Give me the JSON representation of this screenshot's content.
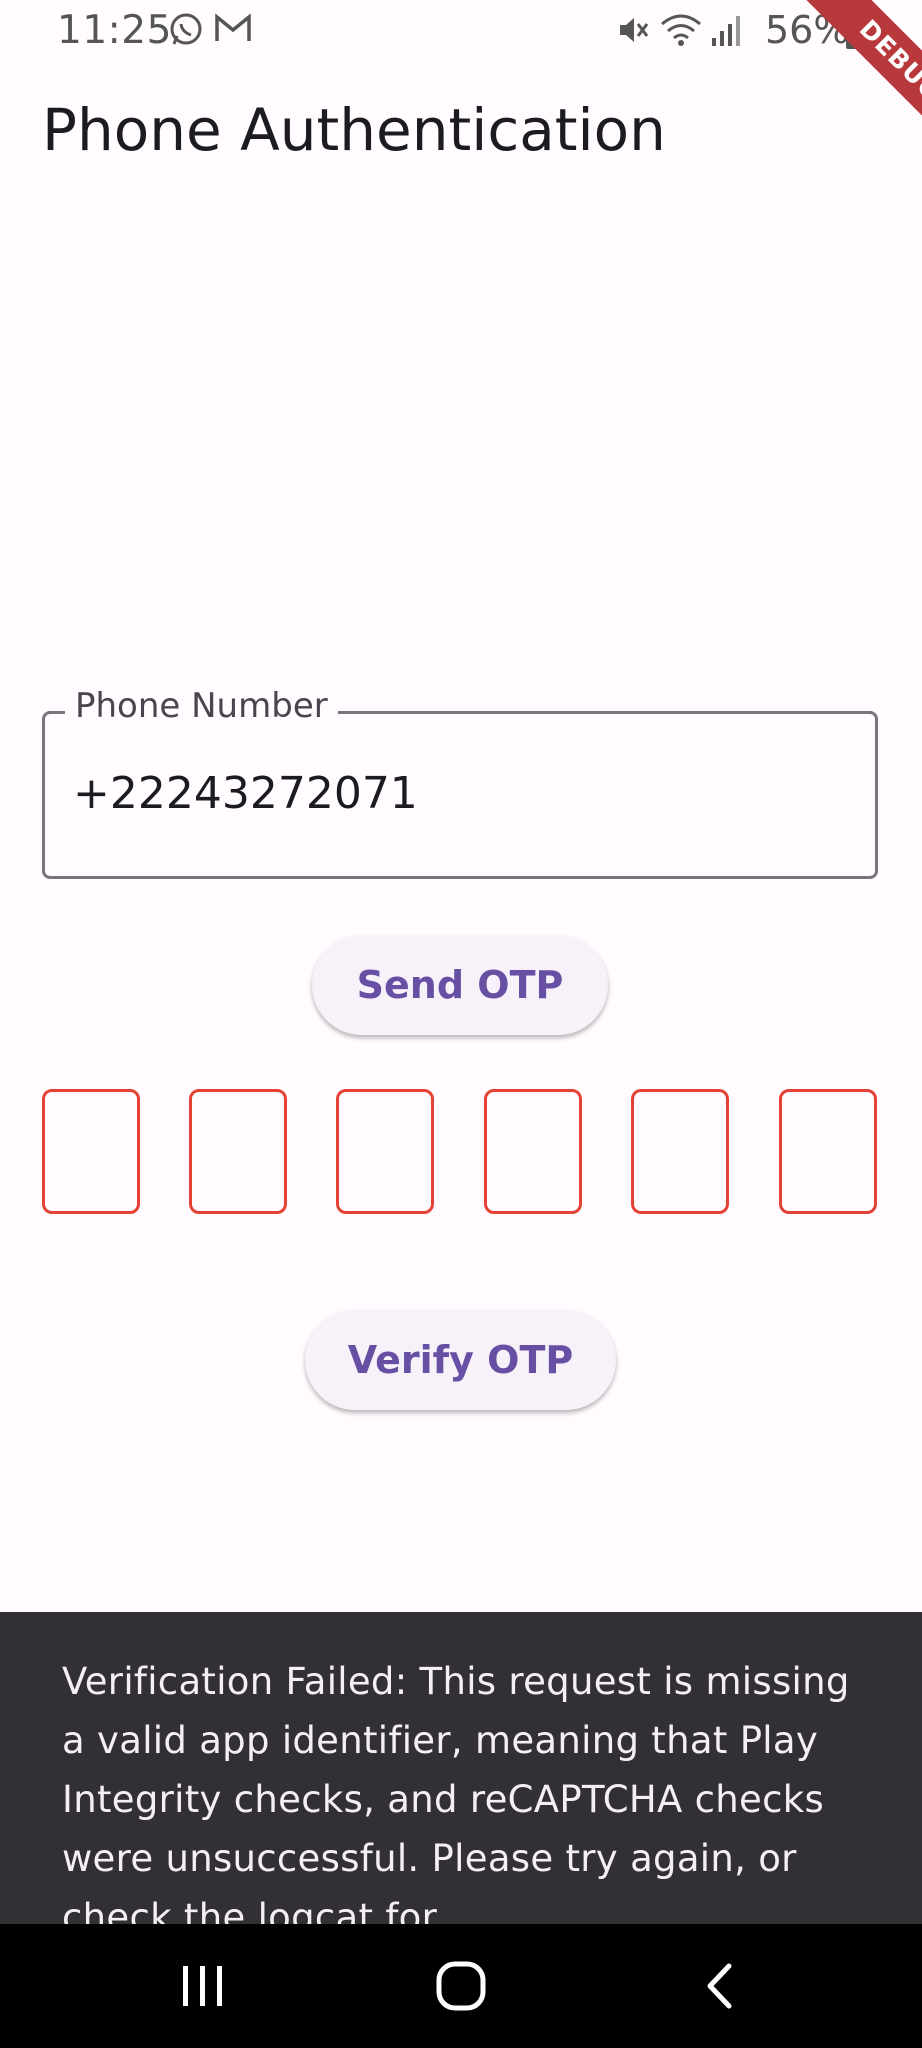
{
  "status_bar": {
    "time": "11:25",
    "battery": "56%",
    "icons": [
      "whatsapp-icon",
      "gmail-icon",
      "mute-icon",
      "wifi-icon",
      "signal-icon",
      "battery-icon"
    ]
  },
  "debug_banner": "DEBUG",
  "app_bar": {
    "title": "Phone Authentication"
  },
  "phone_field": {
    "label": "Phone Number",
    "value": "+22243272071"
  },
  "send_otp_button": {
    "label": "Send OTP"
  },
  "otp_boxes": [
    "",
    "",
    "",
    "",
    "",
    ""
  ],
  "verify_otp_button": {
    "label": "Verify OTP"
  },
  "snackbar": {
    "message": "Verification Failed: This request is missing a valid app identifier, meaning that Play Integrity checks, and reCAPTCHA checks were unsuccessful. Please try again, or check the logcat for"
  },
  "colors": {
    "primary": "#6750a4",
    "otp_border": "#e44235",
    "debug_banner": "#b8393c",
    "snackbar_bg": "#323034"
  },
  "nav_bar": {
    "icons": [
      "recents-icon",
      "home-icon",
      "back-icon"
    ]
  }
}
